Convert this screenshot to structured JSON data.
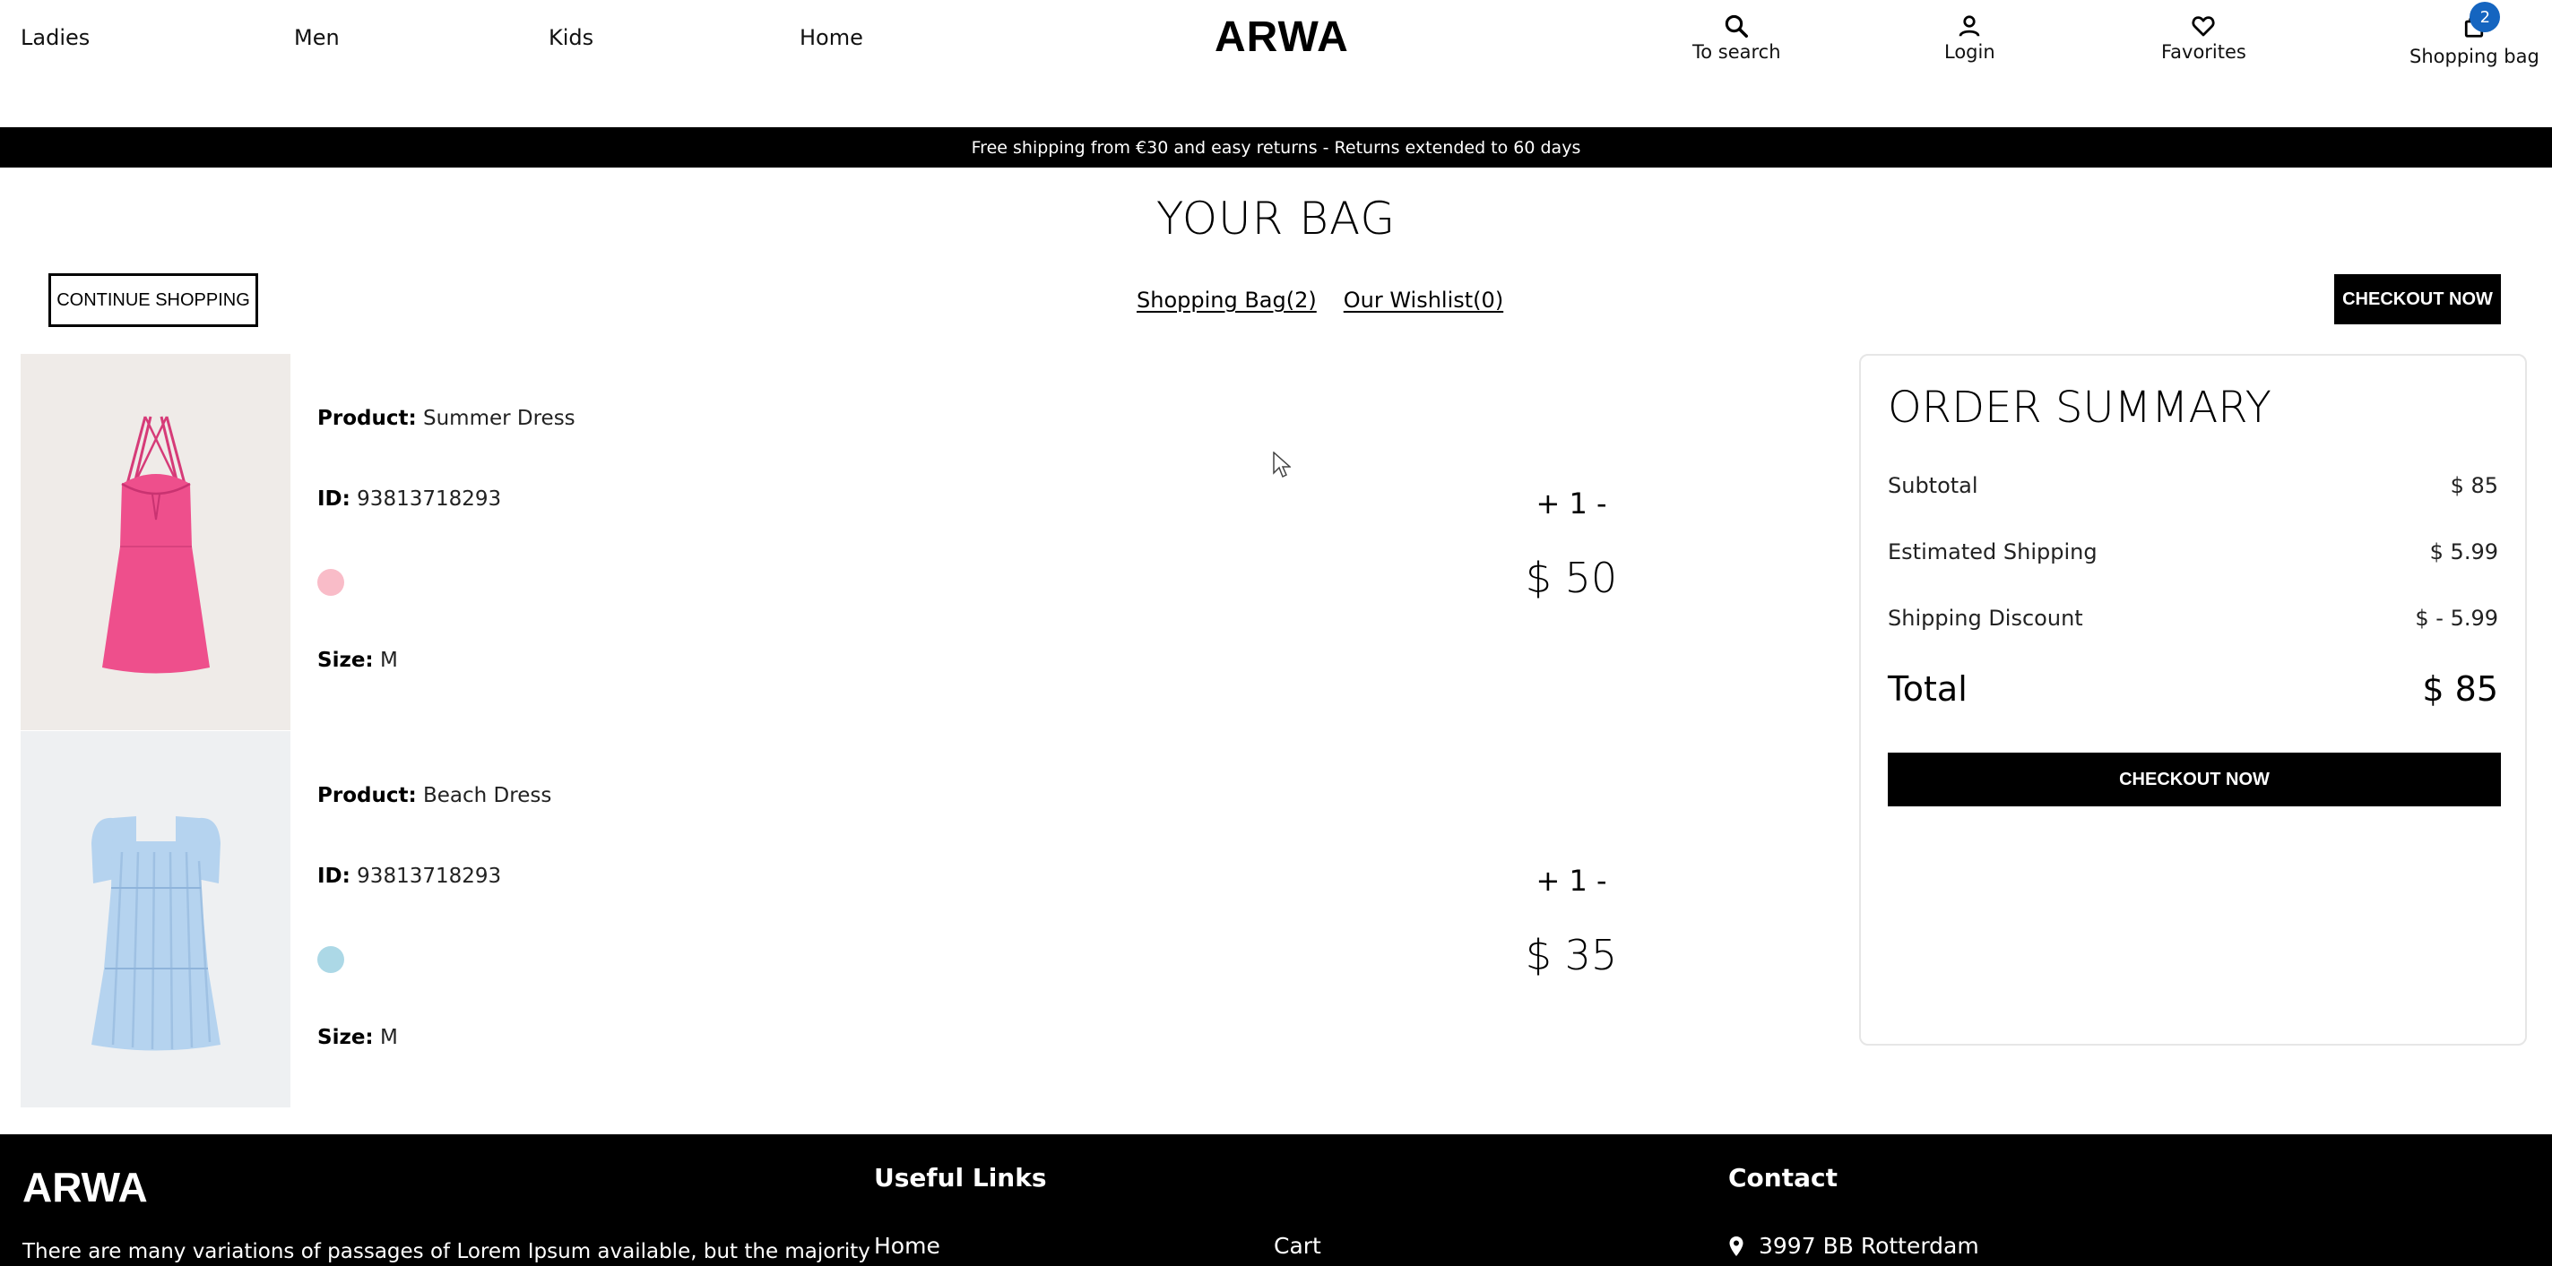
{
  "header": {
    "nav": [
      "Ladies",
      "Men",
      "Kids",
      "Home"
    ],
    "logo": "ARWA",
    "utils": {
      "search": "To search",
      "login": "Login",
      "favorites": "Favorites",
      "bag": "Shopping bag",
      "bag_count": "2"
    }
  },
  "promo": "Free shipping from €30 and easy returns - Returns extended to 60 days",
  "bag": {
    "title": "YOUR BAG",
    "continue_label": "CONTINUE SHOPPING",
    "tab_bag": "Shopping Bag(2)",
    "tab_wishlist": "Our Wishlist(0)",
    "checkout_label": "CHECKOUT NOW"
  },
  "labels": {
    "product": "Product:",
    "id": "ID:",
    "size": "Size:"
  },
  "items": [
    {
      "name": "Summer Dress",
      "id": "93813718293",
      "color": "#f9bcc8",
      "size": "M",
      "qty": "+ 1 -",
      "price": "$ 50"
    },
    {
      "name": "Beach Dress",
      "id": "93813718293",
      "color": "#acd8e6",
      "size": "M",
      "qty": "+ 1 -",
      "price": "$ 35"
    }
  ],
  "summary": {
    "title": "ORDER SUMMARY",
    "subtotal_label": "Subtotal",
    "subtotal": "$ 85",
    "shipping_label": "Estimated Shipping",
    "shipping": "$ 5.99",
    "discount_label": "Shipping Discount",
    "discount": "$ - 5.99",
    "total_label": "Total",
    "total": "$ 85",
    "checkout_label": "CHECKOUT NOW"
  },
  "footer": {
    "logo": "ARWA",
    "text": "There are many variations of passages of Lorem Ipsum available, but the majority",
    "links_title": "Useful Links",
    "link_home": "Home",
    "link_cart": "Cart",
    "contact_title": "Contact",
    "address": "3997 BB Rotterdam"
  },
  "colors": {
    "accent": "#000000",
    "badge": "#1565c0",
    "dress1": "#ee4f8c",
    "dress2": "#b5d3ef"
  }
}
